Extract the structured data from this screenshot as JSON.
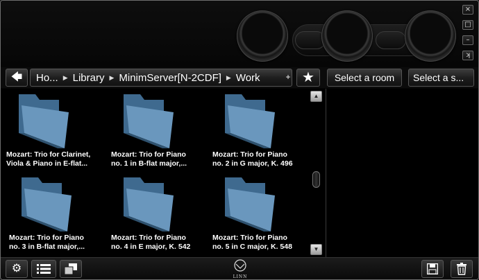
{
  "window_controls": [
    "close",
    "maximize",
    "minimize",
    "compact"
  ],
  "breadcrumb": {
    "back_icon": "arrow-left-icon",
    "items": [
      "Ho...",
      "Library",
      "MinimServer[N-2CDF]",
      "Work"
    ],
    "add_label": "+"
  },
  "header_buttons": {
    "favorite_icon": "star-icon",
    "room_label": "Select a room",
    "source_label": "Select a s..."
  },
  "browser": {
    "items": [
      {
        "label_line1": "Mozart: Trio for Clarinet,",
        "label_line2": "Viola & Piano in E-flat..."
      },
      {
        "label_line1": "Mozart: Trio for Piano",
        "label_line2": "no. 1 in B-flat major,..."
      },
      {
        "label_line1": "Mozart: Trio for Piano",
        "label_line2": "no. 2 in G major, K. 496"
      },
      {
        "label_line1": "Mozart: Trio for Piano",
        "label_line2": "no. 3 in B-flat major,..."
      },
      {
        "label_line1": "Mozart: Trio for Piano",
        "label_line2": "no. 4 in E major, K. 542"
      },
      {
        "label_line1": "Mozart: Trio for Piano",
        "label_line2": "no. 5 in C major, K. 548"
      }
    ]
  },
  "footer": {
    "logo_text": "LINN",
    "icons": [
      "gear-icon",
      "list-icon",
      "tiles-icon",
      "floppy-disk-icon",
      "trash-icon"
    ]
  },
  "colors": {
    "background": "#000000",
    "folder": "#5d88ad",
    "text": "#ffffff"
  }
}
